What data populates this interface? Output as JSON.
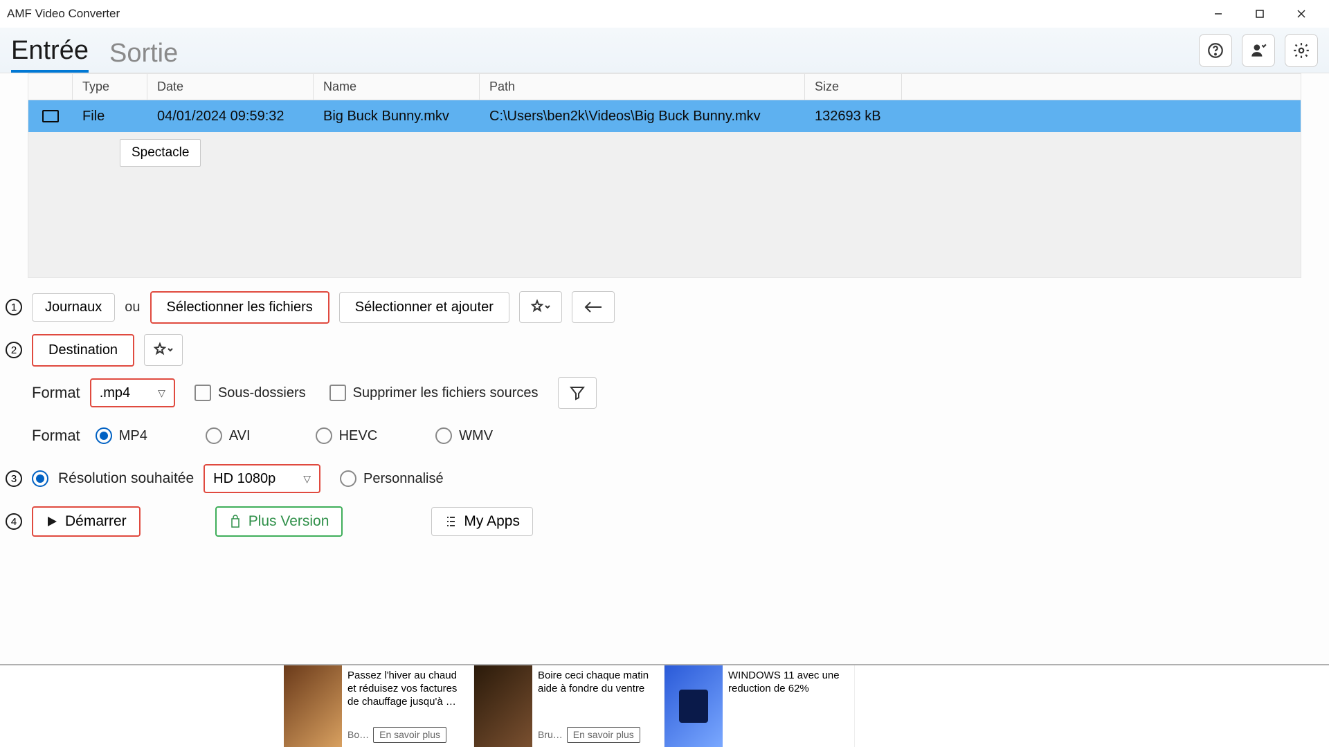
{
  "window": {
    "title": "AMF Video Converter"
  },
  "tabs": {
    "input": "Entrée",
    "output": "Sortie"
  },
  "icons": {
    "help": "help-icon",
    "account": "account-icon",
    "settings": "settings-icon"
  },
  "table": {
    "headers": {
      "type": "Type",
      "date": "Date",
      "name": "Name",
      "path": "Path",
      "size": "Size"
    },
    "row": {
      "type": "File",
      "date": "04/01/2024 09:59:32",
      "name": "Big Buck Bunny.mkv",
      "path": "C:\\Users\\ben2k\\Videos\\Big Buck Bunny.mkv",
      "size": "132693 kB"
    },
    "spectacle": "Spectacle"
  },
  "steps": {
    "one": "1",
    "two": "2",
    "three": "3",
    "four": "4"
  },
  "controls": {
    "journaux": "Journaux",
    "ou": "ou",
    "select_files": "Sélectionner les fichiers",
    "select_add": "Sélectionner et ajouter",
    "destination": "Destination",
    "format_label": "Format",
    "format_value": ".mp4",
    "subfolders": "Sous-dossiers",
    "delete_source": "Supprimer les fichiers sources",
    "format2_label": "Format",
    "codec_mp4": "MP4",
    "codec_avi": "AVI",
    "codec_hevc": "HEVC",
    "codec_wmv": "WMV",
    "resolution_label": "Résolution souhaitée",
    "resolution_value": "HD 1080p",
    "custom": "Personnalisé",
    "start": "Démarrer",
    "plus": "Plus Version",
    "myapps": "My Apps"
  },
  "ads": {
    "a1": {
      "text": "Passez l'hiver au chaud et réduisez vos factures de chauffage jusqu'à …",
      "src": "Bo…",
      "link": "En savoir plus"
    },
    "a2": {
      "text": "Boire ceci chaque matin aide à fondre du ventre",
      "src": "Bru…",
      "link": "En savoir plus"
    },
    "a3": {
      "text": "WINDOWS 11 avec une reduction de 62%"
    }
  }
}
